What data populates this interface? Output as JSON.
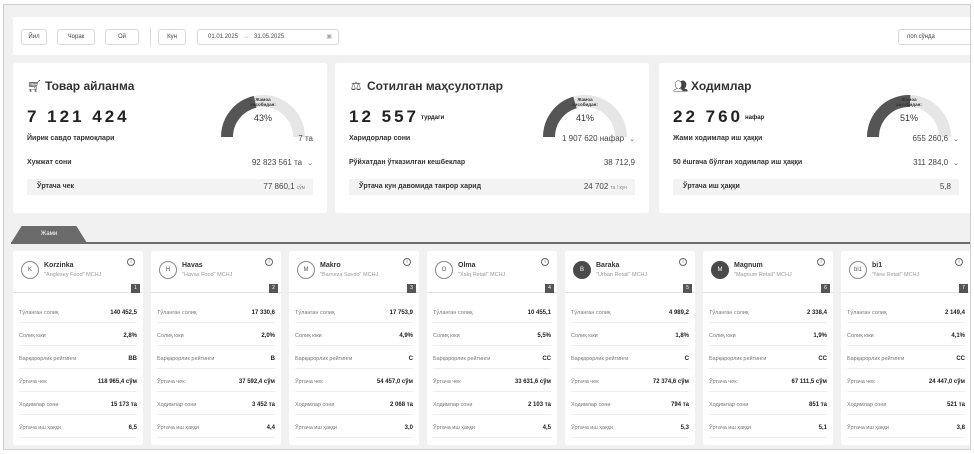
{
  "filters": {
    "periods": [
      "Йил",
      "Чорак",
      "Ой",
      "Кун"
    ],
    "date_from": "01.01.2025",
    "date_sep": "→",
    "date_to": "31.05.2025",
    "select_value": "non сўнда"
  },
  "kpis": [
    {
      "icon": "cart-icon",
      "title": "Товар айланма",
      "big": "7 121 424",
      "big_unit": "",
      "gauge_label": "Жамоа хисобидан:",
      "gauge_value": "43%",
      "gauge_fraction": 0.43,
      "rows": [
        {
          "label": "Йирик савдо тармоқлари",
          "value": "7 та",
          "unit": "",
          "chevron": false,
          "shaded": false
        },
        {
          "label": "Хужжат сони",
          "value": "92 823 561 та",
          "unit": "",
          "chevron": true,
          "shaded": false
        },
        {
          "label": "Ўртача чек",
          "value": "77 860,1",
          "unit": "сўм",
          "chevron": false,
          "shaded": true
        }
      ]
    },
    {
      "icon": "products-sold-icon",
      "title": "Сотилган маҳсулотлар",
      "big": "12 557",
      "big_unit": "турдаги",
      "gauge_label": "Жамоа хисобидан:",
      "gauge_value": "41%",
      "gauge_fraction": 0.41,
      "rows": [
        {
          "label": "Харидорлар сони",
          "value": "1 907 620 нафар",
          "unit": "",
          "chevron": true,
          "shaded": false
        },
        {
          "label": "Рўйхатдан ўтказилган кешбеклар",
          "value": "38 712,9",
          "unit": "",
          "chevron": false,
          "shaded": false
        },
        {
          "label": "Ўртача кун давомида такрор харид",
          "value": "24 702",
          "unit": "та / кун",
          "chevron": false,
          "shaded": true
        }
      ]
    },
    {
      "icon": "users-icon",
      "title": "Ходимлар",
      "big": "22 760",
      "big_unit": "нафар",
      "gauge_label": "Жамоа хисобидан:",
      "gauge_value": "51%",
      "gauge_fraction": 0.51,
      "rows": [
        {
          "label": "Жами ходимлар иш ҳаққи",
          "value": "655 260,6",
          "unit": "",
          "chevron": true,
          "shaded": false
        },
        {
          "label": "50 ёшгача бўлган ходимлар иш ҳаққи",
          "value": "311 284,0",
          "unit": "",
          "chevron": true,
          "shaded": false
        },
        {
          "label": "Ўртача иш ҳаққи",
          "value": "5,8",
          "unit": "",
          "chevron": false,
          "shaded": true
        }
      ]
    }
  ],
  "tab_label": "Жами",
  "stores": [
    {
      "name": "Korzinka",
      "sub": "\"Anglesey Food\" MCHJ",
      "logo": "K",
      "num": "1",
      "rows": [
        [
          "Тўланган солиқ",
          "140 452,5"
        ],
        [
          "Солиқ юки",
          "2,8%"
        ],
        [
          "Барқарорлик рейтинги",
          "BB"
        ],
        [
          "Ўртача чек",
          "118 965,4 сўм"
        ],
        [
          "Ходимлар сони",
          "15 173 та"
        ],
        [
          "Ўртача иш ҳаққи",
          "6,5"
        ]
      ]
    },
    {
      "name": "Havas",
      "sub": "\"Havas Food\" MCHJ",
      "logo": "H",
      "num": "2",
      "rows": [
        [
          "Тўланган солиқ",
          "17 330,6"
        ],
        [
          "Солиқ юки",
          "2,0%"
        ],
        [
          "Барқарорлик рейтинги",
          "B"
        ],
        [
          "Ўртача чек",
          "37 592,4 сўм"
        ],
        [
          "Ходимлар сони",
          "3 452 та"
        ],
        [
          "Ўртача иш ҳаққи",
          "4,4"
        ]
      ]
    },
    {
      "name": "Makro",
      "sub": "\"Barneza Savdo\" MCHJ",
      "logo": "M",
      "num": "3",
      "rows": [
        [
          "Тўланган солиқ",
          "17 753,9"
        ],
        [
          "Солиқ юки",
          "4,9%"
        ],
        [
          "Барқарорлик рейтинги",
          "C"
        ],
        [
          "Ўртача чек",
          "54 457,0 сўм"
        ],
        [
          "Ходимлар сони",
          "2 068 та"
        ],
        [
          "Ўртача иш ҳаққи",
          "3,0"
        ]
      ]
    },
    {
      "name": "Olma",
      "sub": "\"Xalq Retail\" MCHJ",
      "logo": "O",
      "num": "4",
      "rows": [
        [
          "Тўланган солиқ",
          "10 455,1"
        ],
        [
          "Солиқ юки",
          "5,5%"
        ],
        [
          "Барқарорлик рейтинги",
          "CC"
        ],
        [
          "Ўртача чек",
          "33 631,6 сўм"
        ],
        [
          "Ходимлар сони",
          "2 103 та"
        ],
        [
          "Ўртача иш ҳаққи",
          "4,5"
        ]
      ]
    },
    {
      "name": "Baraka",
      "sub": "\"Urban Retail\" MCHJ",
      "logo": "B",
      "num": "5",
      "rows": [
        [
          "Тўланган солиқ",
          "4 989,2"
        ],
        [
          "Солиқ юки",
          "1,8%"
        ],
        [
          "Барқарорлик рейтинги",
          "C"
        ],
        [
          "Ўртача чек",
          "72 374,6 сўм"
        ],
        [
          "Ходимлар сони",
          "794 та"
        ],
        [
          "Ўртача иш ҳаққи",
          "5,3"
        ]
      ]
    },
    {
      "name": "Magnum",
      "sub": "\"Magnum Retail\" MCHJ",
      "logo": "M",
      "num": "6",
      "rows": [
        [
          "Тўланган солиқ",
          "2 338,4"
        ],
        [
          "Солиқ юки",
          "1,9%"
        ],
        [
          "Барқарорлик рейтинги",
          "CC"
        ],
        [
          "Ўртача чек",
          "67 111,5 сўм"
        ],
        [
          "Ходимлар сони",
          "851 та"
        ],
        [
          "Ўртача иш ҳаққи",
          "5,1"
        ]
      ]
    },
    {
      "name": "bi1",
      "sub": "\"New Retail\" MCHJ",
      "logo": "bi1",
      "num": "7",
      "rows": [
        [
          "Тўланган солиқ",
          "2 149,4"
        ],
        [
          "Солиқ юки",
          "4,1%"
        ],
        [
          "Барқарорлик рейтинги",
          "CC"
        ],
        [
          "Ўртача чек",
          "24 447,0 сўм"
        ],
        [
          "Ходимлар сони",
          "521 та"
        ],
        [
          "Ўртача иш ҳаққи",
          "3,8"
        ]
      ]
    }
  ]
}
